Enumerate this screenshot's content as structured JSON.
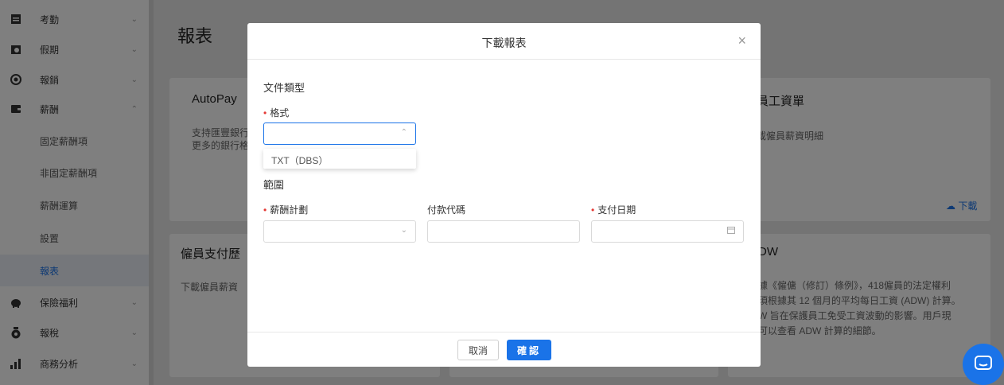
{
  "sidebar": {
    "items": [
      {
        "label": "考勤",
        "icon": "calendar-icon",
        "expanded": false
      },
      {
        "label": "假期",
        "icon": "leave-icon",
        "expanded": false
      },
      {
        "label": "報銷",
        "icon": "claim-icon",
        "expanded": false
      },
      {
        "label": "薪酬",
        "icon": "wallet-icon",
        "expanded": true
      },
      {
        "label": "保險福利",
        "icon": "piggy-bank-icon",
        "expanded": false
      },
      {
        "label": "報稅",
        "icon": "tax-bag-icon",
        "expanded": false
      },
      {
        "label": "商務分析",
        "icon": "bar-chart-icon",
        "expanded": false
      }
    ],
    "payroll_sub": [
      "固定薪酬項",
      "非固定薪酬項",
      "薪酬運算",
      "設置",
      "報表"
    ],
    "active_sub": "報表"
  },
  "page": {
    "title": "報表",
    "cards": {
      "autopay_title": "AutoPay",
      "autopay_text_1": "支持匯豐銀行",
      "autopay_text_2": "更多的銀行格",
      "payslip_title": "員工資單",
      "payslip_text": "載僱員薪資明細",
      "payslip_download": "下載",
      "employee_pay_title": "僱員支付歷",
      "employee_pay_text": "下載僱員薪資",
      "adw_title": "DW",
      "adw_text_1": "據《僱傭（修訂）條例》，418僱員的法定權利",
      "adw_text_2": "須根據其 12 個月的平均每日工資 (ADW) 計算。",
      "adw_text_3": "W 旨在保護員工免受工資波動的影響。用戶現",
      "adw_text_4": "可以查看 ADW 計算的細節。"
    }
  },
  "modal": {
    "title": "下載報表",
    "close": "×",
    "doc_type_section": "文件類型",
    "format_label": "格式",
    "format_value": "",
    "format_option": "TXT（DBS）",
    "range_section": "範圍",
    "payroll_plan_label": "薪酬計劃",
    "payroll_plan_value": "",
    "payment_code_label": "付款代碼",
    "payment_code_value": "",
    "payment_date_label": "支付日期",
    "payment_date_value": "",
    "cancel_label": "取消",
    "confirm_label": "確認"
  },
  "colors": {
    "primary": "#1a73e8",
    "required": "#e53935"
  }
}
